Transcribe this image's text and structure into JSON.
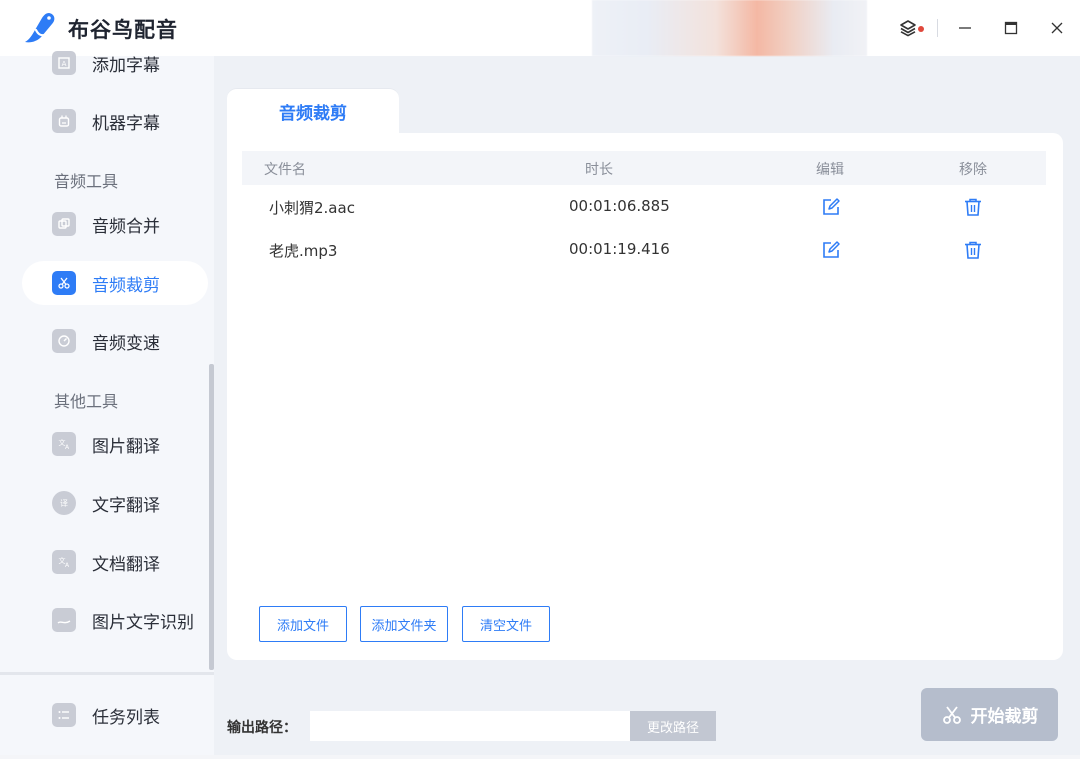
{
  "app": {
    "title": "布谷鸟配音"
  },
  "colors": {
    "accent": "#2e7cf6",
    "danger": "#e0483c",
    "disabled": "#b5bdcc"
  },
  "sidebar": {
    "items_top": [
      {
        "label": "添加字幕",
        "icon": "subtitle-add-icon"
      },
      {
        "label": "机器字幕",
        "icon": "robot-icon"
      }
    ],
    "section_audio": "音频工具",
    "items_audio": [
      {
        "label": "音频合并",
        "icon": "merge-icon"
      },
      {
        "label": "音频裁剪",
        "icon": "scissors-icon",
        "active": true
      },
      {
        "label": "音频变速",
        "icon": "speed-icon"
      }
    ],
    "section_other": "其他工具",
    "items_other": [
      {
        "label": "图片翻译",
        "icon": "image-translate-icon"
      },
      {
        "label": "文字翻译",
        "icon": "text-translate-icon"
      },
      {
        "label": "文档翻译",
        "icon": "document-translate-icon"
      },
      {
        "label": "图片文字识别",
        "icon": "ocr-icon"
      }
    ],
    "task_list": "任务列表"
  },
  "main": {
    "tab": "音频裁剪",
    "table": {
      "headers": {
        "name": "文件名",
        "duration": "时长",
        "edit": "编辑",
        "remove": "移除"
      },
      "rows": [
        {
          "name": "小刺猬2.aac",
          "duration": "00:01:06.885"
        },
        {
          "name": "老虎.mp3",
          "duration": "00:01:19.416"
        }
      ]
    },
    "buttons": {
      "add_file": "添加文件",
      "add_folder": "添加文件夹",
      "clear": "清空文件"
    }
  },
  "output": {
    "label": "输出路径：",
    "path_value": "",
    "change_button": "更改路径"
  },
  "start_button": "开始裁剪"
}
